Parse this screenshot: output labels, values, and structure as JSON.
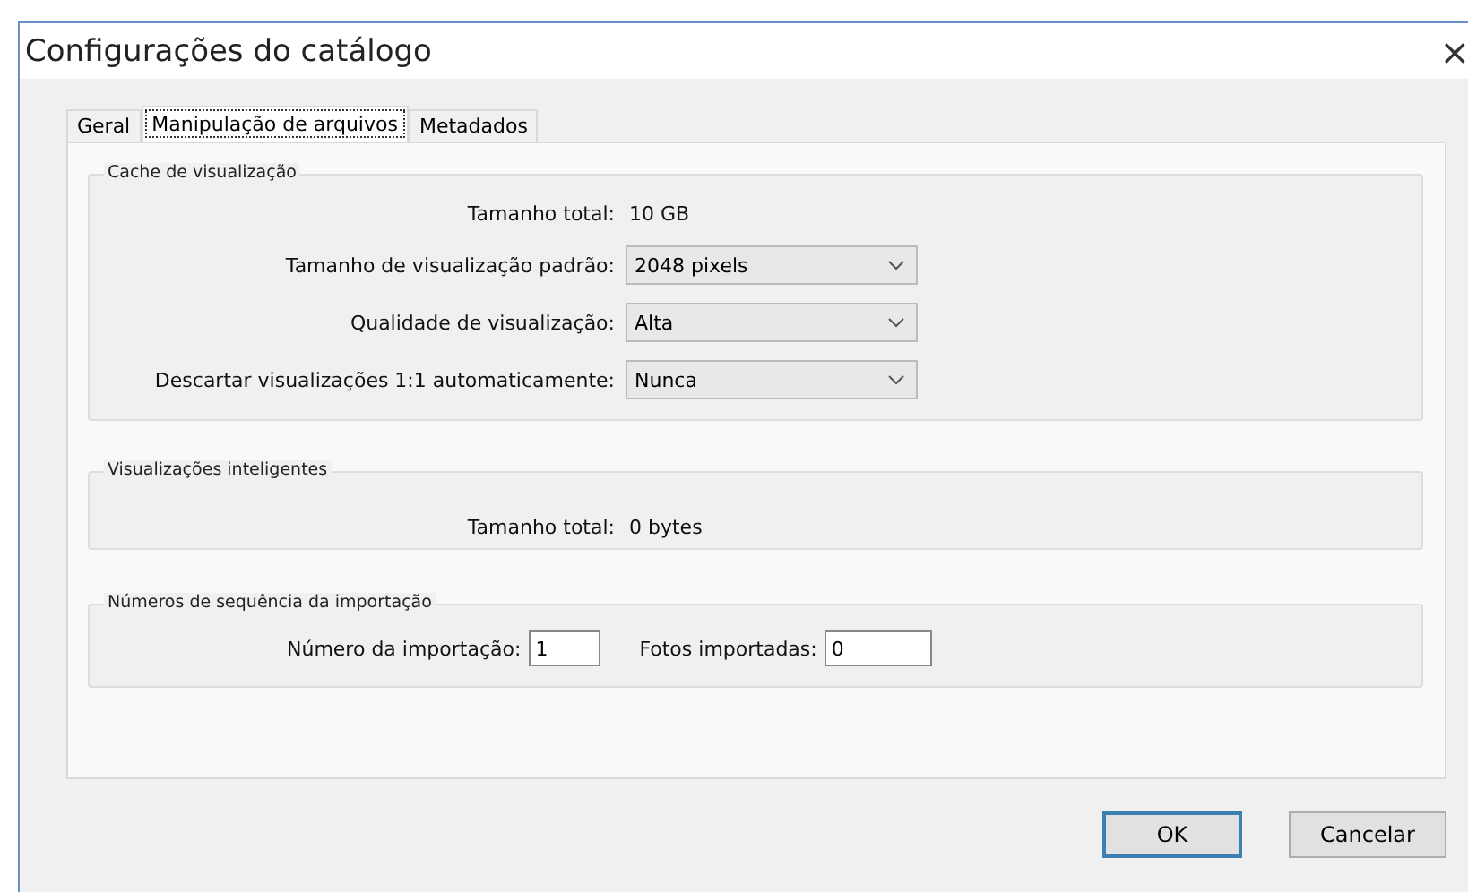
{
  "window": {
    "title": "Configurações do catálogo",
    "close": "×"
  },
  "tabs": [
    {
      "label": "Geral",
      "selected": false
    },
    {
      "label": "Manipulação de arquivos",
      "selected": true
    },
    {
      "label": "Metadados",
      "selected": false
    }
  ],
  "groups": [
    {
      "title": "Cache de visualização",
      "rows": [
        {
          "kind": "text",
          "label": "Tamanho total:",
          "value": "10 GB"
        },
        {
          "kind": "dropdown",
          "label": "Tamanho de visualização padrão:",
          "value": "2048 pixels"
        },
        {
          "kind": "dropdown",
          "label": "Qualidade de visualização:",
          "value": "Alta"
        },
        {
          "kind": "dropdown",
          "label": "Descartar visualizações 1:1 automaticamente:",
          "value": "Nunca"
        }
      ]
    },
    {
      "title": "Visualizações inteligentes",
      "rows": [
        {
          "kind": "text",
          "label": "Tamanho total:",
          "value": "0 bytes"
        }
      ]
    },
    {
      "title": "Números de sequência da importação",
      "fields": [
        {
          "label": "Número da importação:",
          "value": "1"
        },
        {
          "label": "Fotos importadas:",
          "value": "0"
        }
      ]
    }
  ],
  "buttons": [
    {
      "label": "OK",
      "default": true
    },
    {
      "label": "Cancelar",
      "default": false
    }
  ]
}
